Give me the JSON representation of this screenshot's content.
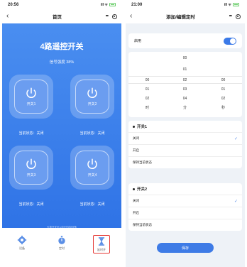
{
  "colors": {
    "accent": "#3e7be6",
    "panel_gradient_top": "#4a8ef0",
    "panel_gradient_bottom": "#2f73e6",
    "tab_highlight": "#e53935"
  },
  "left": {
    "status_bar": {
      "time": "20:56",
      "icons": "ill ᯤ"
    },
    "nav": {
      "title": "首页",
      "dots": "•••"
    },
    "panel": {
      "title": "4路遥控开关",
      "signal": "信号强度 38%",
      "switches": [
        {
          "label": "开关1",
          "status": "当前状态：关闭"
        },
        {
          "label": "开关2",
          "status": "当前状态：关闭"
        },
        {
          "label": "开关3",
          "status": "当前状态：关闭"
        },
        {
          "label": "开关4",
          "status": "当前状态：关闭"
        }
      ],
      "footer_note": "长按开关可以定时控制设备"
    },
    "tabs": [
      {
        "label": "设备",
        "icon": "gear-icon"
      },
      {
        "label": "定时",
        "icon": "stopwatch-icon"
      },
      {
        "label": "延时开",
        "icon": "hourglass-icon",
        "active": true
      }
    ]
  },
  "right": {
    "status_bar": {
      "time": "21:00",
      "icons": "ill ᯤ"
    },
    "nav": {
      "title": "添加/编辑定时",
      "dots": "•••"
    },
    "enable_label": "启用",
    "enabled": true,
    "picker": {
      "hours": [
        "00",
        "01",
        "02"
      ],
      "minutes": [
        "00",
        "01",
        "02",
        "03",
        "04"
      ],
      "seconds": [
        "00",
        "01",
        "02"
      ],
      "unit_hour": "时",
      "unit_minute": "分",
      "unit_second": "秒"
    },
    "sections": [
      {
        "title": "开关1",
        "options": [
          "关闭",
          "开启",
          "保持当前状态"
        ],
        "selected_mark": "✓"
      },
      {
        "title": "开关2",
        "options": [
          "关闭",
          "开启",
          "保持当前状态"
        ],
        "selected_mark": "✓"
      }
    ],
    "save_label": "保存"
  }
}
